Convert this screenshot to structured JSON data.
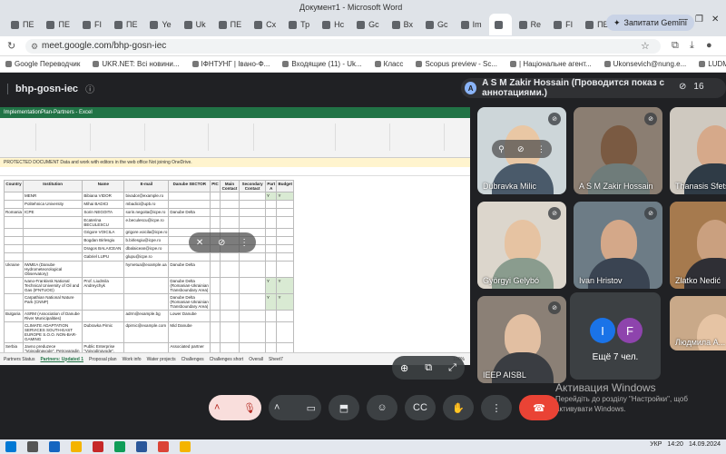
{
  "window": {
    "title": "Документ1 - Microsoft Word",
    "gemini_button": "Запитати Gemini",
    "minimize": "—",
    "maximize": "❐",
    "close": "✕"
  },
  "tabs": [
    {
      "label": "ПЕ"
    },
    {
      "label": "ПЕ"
    },
    {
      "label": "FI"
    },
    {
      "label": "ПЕ"
    },
    {
      "label": "Ye"
    },
    {
      "label": "Uk"
    },
    {
      "label": "ПЕ"
    },
    {
      "label": "Сх"
    },
    {
      "label": "Тр"
    },
    {
      "label": "Нс"
    },
    {
      "label": "Gc"
    },
    {
      "label": "Вх"
    },
    {
      "label": "Gc"
    },
    {
      "label": "Im"
    },
    {
      "label": ""
    },
    {
      "label": "Re"
    },
    {
      "label": "FI"
    },
    {
      "label": "ПЕ"
    }
  ],
  "address": {
    "url": "meet.google.com/bhp-gosn-iec"
  },
  "bookmarks": [
    "Google Переводчик",
    "UKR.NET: Всі новини...",
    "ІФНТУНГ | Івано-Ф...",
    "Входящие (11) - Uk...",
    "Класс",
    "Scopus preview - Sc...",
    "| Національне агент...",
    "Ukonsevich@nung.e...",
    "LUDMILA – Google..."
  ],
  "meet": {
    "meeting_code": "bhp-gosn-iec",
    "presenter_initial": "A",
    "presenter_text": "A S M Zakir Hossain (Проводится показ с аннотациями.)",
    "participant_count": "16"
  },
  "excel": {
    "title_bar": "ImplementationPlan-Partners - Excel",
    "warning": "PROTECTED DOCUMENT  Data and work with editors in the web office Not joining OneDrive.",
    "headers": [
      "Country",
      "Institution",
      "Name",
      "E-mail",
      "Danube SECTOR",
      "PIC",
      "Main Contact",
      "Secondary Contact",
      "Part A",
      "Budget"
    ],
    "rows": [
      [
        "",
        "MENR",
        "Bibiana VIDOR",
        "bivador@example.ro",
        "",
        "",
        "",
        "",
        "Y",
        "Y"
      ],
      [
        "",
        "Politehnica University",
        "Mihai BADICI",
        "mbadici@upb.ro",
        "",
        "",
        "",
        "",
        "",
        ""
      ],
      [
        "Romania",
        "ICPE",
        "Sorin NEGOITA",
        "sorin.negoita@icpe.ro",
        "Danube Delta",
        "",
        "",
        "",
        "",
        ""
      ],
      [
        "",
        "",
        "Ecaterina BECULESCU",
        "e.beculescu@icpe.ro",
        "",
        "",
        "",
        "",
        "",
        ""
      ],
      [
        "",
        "",
        "Grigore VOICILA",
        "grigore.voicila@icpe.ro",
        "",
        "",
        "",
        "",
        "",
        ""
      ],
      [
        "",
        "",
        "Bogdan Birlesgiu",
        "b.birlesgiu@icpe.ro",
        "",
        "",
        "",
        "",
        "",
        ""
      ],
      [
        "",
        "",
        "Dragos BALAICEAN",
        "dbalaicean@icpe.ro",
        "",
        "",
        "",
        "",
        "",
        ""
      ],
      [
        "",
        "",
        "Gabriel LUPU",
        "glupu@icpe.ro",
        "",
        "",
        "",
        "",
        "",
        ""
      ],
      [
        "Ukraine",
        "IWMEA (Danube Hydrometeorological Observatory)",
        "",
        "hymetua@example.ua",
        "Danube Delta",
        "",
        "",
        "",
        "",
        ""
      ],
      [
        "",
        "Ivano-Frankivsk National Technical University of Oil and Gas (IFNTUOG)",
        "Prof. Liudmila Andreychyk",
        "",
        "Danube Delta (Romanian-Ukrainian Transboundary Area)",
        "",
        "",
        "",
        "Y",
        "Y"
      ],
      [
        "",
        "Carpathian National Nature Park (CNNP)",
        "",
        "",
        "Danube Delta (Romanian-Ukrainian Transboundary Area)",
        "",
        "",
        "",
        "Y",
        "Y"
      ],
      [
        "Bulgaria",
        "ASRM (Association of Danube River Municipalities)",
        "",
        "adrm@example.bg",
        "Lower Danube",
        "",
        "",
        "",
        "",
        ""
      ],
      [
        "",
        "CLIMATE ADAPTATION SERVICES SOUTH-EAST EUROPE S.O.O. NON-BAR-GAMING",
        "Dubravka Pirnic",
        "dpirnic@example.com",
        "Mid Danube",
        "",
        "",
        "",
        "",
        ""
      ],
      [
        "Serbia",
        "Javno preduzece \"Vojvodinavode\", Petrovaradin",
        "Public Enterprise \"Vojvodinavode\", Petrovaradin",
        "",
        "Associated partner",
        "",
        "",
        "",
        "",
        ""
      ]
    ],
    "sheet_tabs": [
      "Partners Status",
      "Partners: Updated 1",
      "Proposal plan",
      "Work info",
      "Water projects",
      "Challenges",
      "Challenges short",
      "Overall",
      "Sheet7"
    ],
    "active_sheet": "Partners: Updated 1",
    "zoom": "100%"
  },
  "participants": [
    {
      "name": "Dubravka Milic",
      "bg": "#cdd6d9",
      "face": "#e9c7a4",
      "body": "#4a5a6a",
      "muted": true
    },
    {
      "name": "A S M Zakir Hossain",
      "bg": "#8b7e72",
      "face": "#7a5a42",
      "body": "#6f7c7a",
      "muted": true
    },
    {
      "name": "Thanasis Sfetsos",
      "bg": "#cfc9c0",
      "face": "#d6a98a",
      "body": "#2f3b46",
      "muted": false
    },
    {
      "name": "Györgyi Gelybó",
      "bg": "#dcd6cc",
      "face": "#e6c3a2",
      "body": "#8a9c8e",
      "muted": true
    },
    {
      "name": "Ivan Hristov",
      "bg": "#6d7c86",
      "face": "#d4a889",
      "body": "#3a4452",
      "muted": true
    },
    {
      "name": "Zlatko Nedić",
      "bg": "#a67a4e",
      "face": "#caa07f",
      "body": "#2f2f35",
      "muted": true
    },
    {
      "name": "IEEP AISBL",
      "bg": "#8b8076",
      "face": "#e2bfa2",
      "body": "#3a3d42",
      "muted": true
    },
    {
      "name": "Людмила А...",
      "bg": "#c9a989",
      "face": "#e6c4a4",
      "body": "#8a4e3a",
      "muted": false
    }
  ],
  "others": {
    "initial_1": "I",
    "initial_2": "F",
    "color_1": "#1a73e8",
    "color_2": "#8e44ad",
    "label": "Ещё 7 чел."
  },
  "activation": {
    "title": "Активация Windows",
    "text": "Перейдіть до розділу \"Настройки\", щоб активувати Windows."
  },
  "taskbar": {
    "lang": "УКР",
    "time": "14:20",
    "date": "14.09.2024"
  }
}
